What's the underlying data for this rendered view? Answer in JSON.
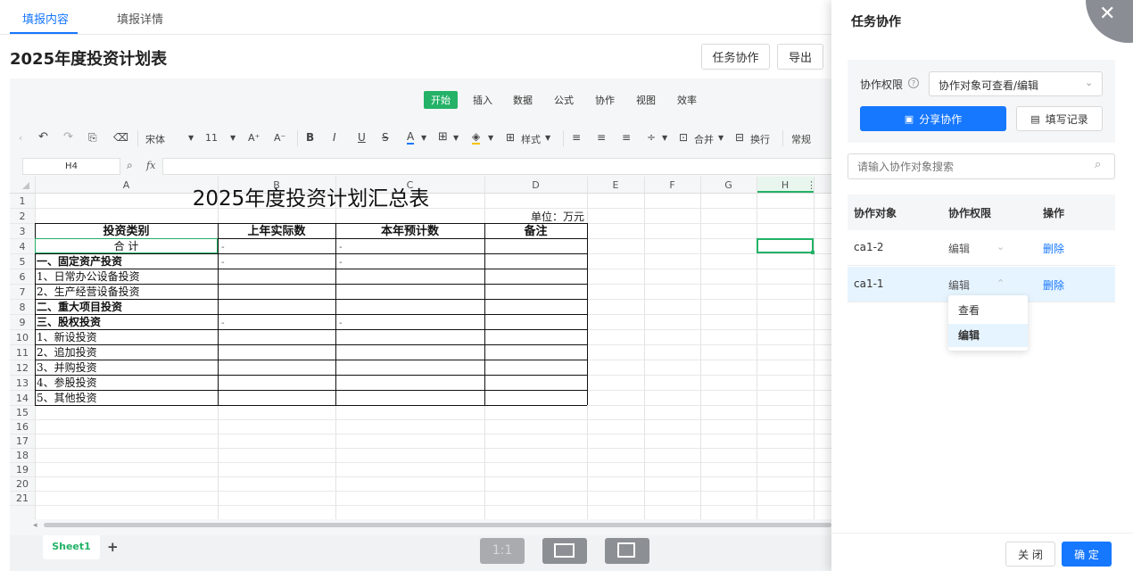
{
  "tabs": [
    {
      "label": "填报内容",
      "active": true
    },
    {
      "label": "填报详情",
      "active": false
    }
  ],
  "page_title": "2025年度投资计划表",
  "header_buttons": {
    "collab": "任务协作",
    "export": "导出"
  },
  "spreadsheet": {
    "menus": [
      "开始",
      "插入",
      "数据",
      "公式",
      "协作",
      "视图",
      "效率"
    ],
    "active_menu": "开始",
    "toolbar": {
      "font": "宋体",
      "size": "11",
      "font_up": "A⁺",
      "font_down": "A⁻",
      "bold": "B",
      "italic": "I",
      "underline": "U",
      "strike": "S",
      "font_color": "A",
      "style": "样式",
      "merge": "合并",
      "wrap": "换行",
      "number_format": "常规"
    },
    "name_box": "H4",
    "fx_label": "fx",
    "columns": [
      "A",
      "B",
      "C",
      "D",
      "E",
      "F",
      "G",
      "H"
    ],
    "rows": [
      "1",
      "2",
      "3",
      "4",
      "5",
      "6",
      "7",
      "8",
      "9",
      "10",
      "11",
      "12",
      "13",
      "14",
      "15",
      "16",
      "17",
      "18",
      "19",
      "20",
      "21"
    ],
    "title": "2025年度投资计划汇总表",
    "unit": "单位：万元",
    "headers": [
      "投资类别",
      "上年实际数",
      "本年预计数",
      "备注"
    ],
    "body": [
      {
        "a": "合  计",
        "b": "-",
        "c": "-",
        "bold": false,
        "center": true
      },
      {
        "a": "一、固定资产投资",
        "b": "-",
        "c": "-",
        "bold": true
      },
      {
        "a": "1、日常办公设备投资",
        "b": "",
        "c": "",
        "bold": false
      },
      {
        "a": "2、生产经营设备投资",
        "b": "",
        "c": "",
        "bold": false
      },
      {
        "a": "二、重大项目投资",
        "b": "",
        "c": "",
        "bold": true
      },
      {
        "a": "三、股权投资",
        "b": "-",
        "c": "-",
        "bold": true
      },
      {
        "a": "1、新设投资",
        "b": "",
        "c": "",
        "bold": false
      },
      {
        "a": "2、追加投资",
        "b": "",
        "c": "",
        "bold": false
      },
      {
        "a": "3、并购投资",
        "b": "",
        "c": "",
        "bold": false
      },
      {
        "a": "4、参股投资",
        "b": "",
        "c": "",
        "bold": false
      },
      {
        "a": "5、其他投资",
        "b": "",
        "c": "",
        "bold": false
      }
    ],
    "sheet_tab": "Sheet1",
    "add_sheet": "+",
    "zoom_label": "1:1"
  },
  "panel": {
    "title": "任务协作",
    "perm_label": "协作权限",
    "perm_value": "协作对象可查看/编辑",
    "share_btn": "分享协作",
    "record_btn": "填写记录",
    "search_placeholder": "请输入协作对象搜索",
    "table_headers": [
      "协作对象",
      "协作权限",
      "操作"
    ],
    "rows": [
      {
        "name": "ca1-2",
        "perm": "编辑",
        "action": "删除"
      },
      {
        "name": "ca1-1",
        "perm": "编辑",
        "action": "删除"
      }
    ],
    "dropdown_options": [
      "查看",
      "编辑"
    ],
    "dropdown_selected": "编辑",
    "cancel": "关 闭",
    "ok": "确 定"
  },
  "colors": {
    "accent": "#1677ff",
    "sheet_green": "#23b267",
    "selected_row": "#e6f4ff"
  }
}
